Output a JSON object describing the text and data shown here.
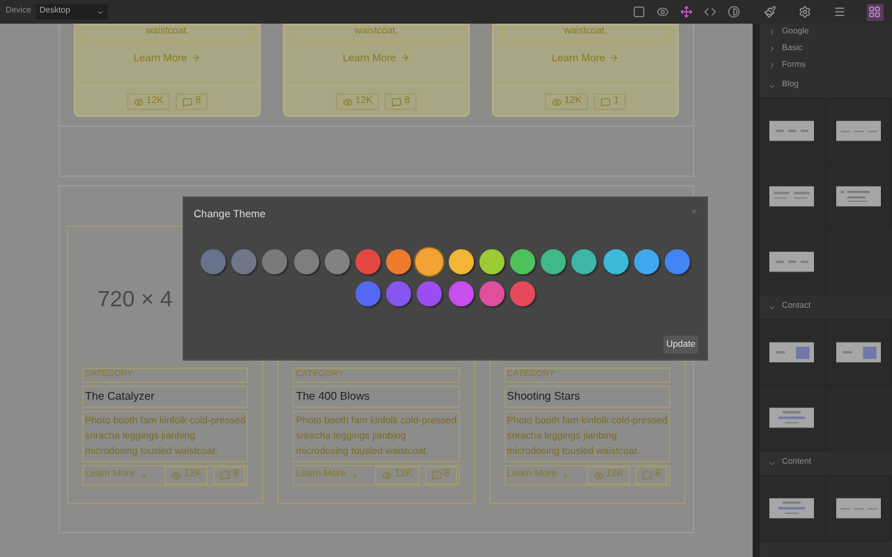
{
  "topbar": {
    "device_label": "Device",
    "device_value": "Desktop"
  },
  "toolbar": [
    {
      "kind": "square",
      "active": false
    },
    {
      "kind": "eye",
      "active": false
    },
    {
      "kind": "fullscreen",
      "active": true
    },
    {
      "kind": "code",
      "active": false
    },
    {
      "kind": "contrast",
      "active": false
    }
  ],
  "panel_tabs": [
    {
      "kind": "brush",
      "selected": false
    },
    {
      "kind": "gear",
      "selected": false
    },
    {
      "kind": "layers",
      "selected": false
    },
    {
      "kind": "blocks",
      "selected": true
    }
  ],
  "top_cards": [
    {
      "text_end": "waistcoat.",
      "link": "Learn More",
      "views": "12K",
      "comments": "8"
    },
    {
      "text_end": "waistcoat.",
      "link": "Learn More",
      "views": "12K",
      "comments": "8"
    },
    {
      "text_end": "waistcoat.",
      "link": "Learn More",
      "views": "12K",
      "comments": "1"
    }
  ],
  "bottom_cards": [
    {
      "image_text": "720 × 4",
      "category": "CATEGORY",
      "title": "The Catalyzer",
      "description": "Photo booth fam kinfolk cold-pressed sriracha leggings jianbing microdosing tousled waistcoat.",
      "link": "Learn More",
      "views": "12K",
      "comments": "8"
    },
    {
      "category": "CATEGORY",
      "title": "The 400 Blows",
      "description": "Photo booth fam kinfolk cold-pressed sriracha leggings jianbing microdosing tousled waistcoat.",
      "link": "Learn More",
      "views": "12K",
      "comments": "8"
    },
    {
      "category": "CATEGORY",
      "title": "Shooting Stars",
      "description": "Photo booth fam kinfolk cold-pressed sriracha leggings jianbing microdosing tousled waistcoat.",
      "link": "Learn More",
      "views": "12K",
      "comments": "8"
    }
  ],
  "modal": {
    "title": "Change Theme",
    "close": "×",
    "button": "Update",
    "swatches": [
      {
        "color": "#66738a",
        "selected": false
      },
      {
        "color": "#707789",
        "selected": false
      },
      {
        "color": "#7a7a7a",
        "selected": false
      },
      {
        "color": "#7e7e7e",
        "selected": false
      },
      {
        "color": "#838280",
        "selected": false
      },
      {
        "color": "#e54840",
        "selected": false
      },
      {
        "color": "#ee7a2c",
        "selected": false
      },
      {
        "color": "#f2a236",
        "selected": true
      },
      {
        "color": "#f0b634",
        "selected": false
      },
      {
        "color": "#9ccb36",
        "selected": false
      },
      {
        "color": "#4ec25c",
        "selected": false
      },
      {
        "color": "#3fb985",
        "selected": false
      },
      {
        "color": "#3cb7a8",
        "selected": false
      },
      {
        "color": "#3bbbd9",
        "selected": false
      },
      {
        "color": "#3ea8ee",
        "selected": false
      },
      {
        "color": "#4285f4",
        "selected": false
      },
      {
        "color": "#5468f2",
        "selected": false
      },
      {
        "color": "#8756f0",
        "selected": false
      },
      {
        "color": "#9b4ef0",
        "selected": false
      },
      {
        "color": "#c84ef0",
        "selected": false
      },
      {
        "color": "#df4f9b",
        "selected": false
      },
      {
        "color": "#e6495a",
        "selected": false
      }
    ]
  },
  "sidebar": {
    "categories": [
      {
        "label": "Google",
        "expanded": false
      },
      {
        "label": "Basic",
        "expanded": false
      },
      {
        "label": "Forms",
        "expanded": false
      },
      {
        "label": "Blog",
        "expanded": true,
        "blocks": [
          {
            "kind": "columns"
          },
          {
            "kind": "row"
          },
          {
            "kind": "split"
          },
          {
            "kind": "list"
          },
          {
            "kind": "columns"
          }
        ]
      },
      {
        "label": "Contact",
        "expanded": true,
        "blocks": [
          {
            "kind": "form"
          },
          {
            "kind": "form"
          },
          {
            "kind": "centered"
          }
        ]
      },
      {
        "label": "Content",
        "expanded": true,
        "blocks": [
          {
            "kind": "centered"
          },
          {
            "kind": "row"
          }
        ]
      }
    ]
  }
}
